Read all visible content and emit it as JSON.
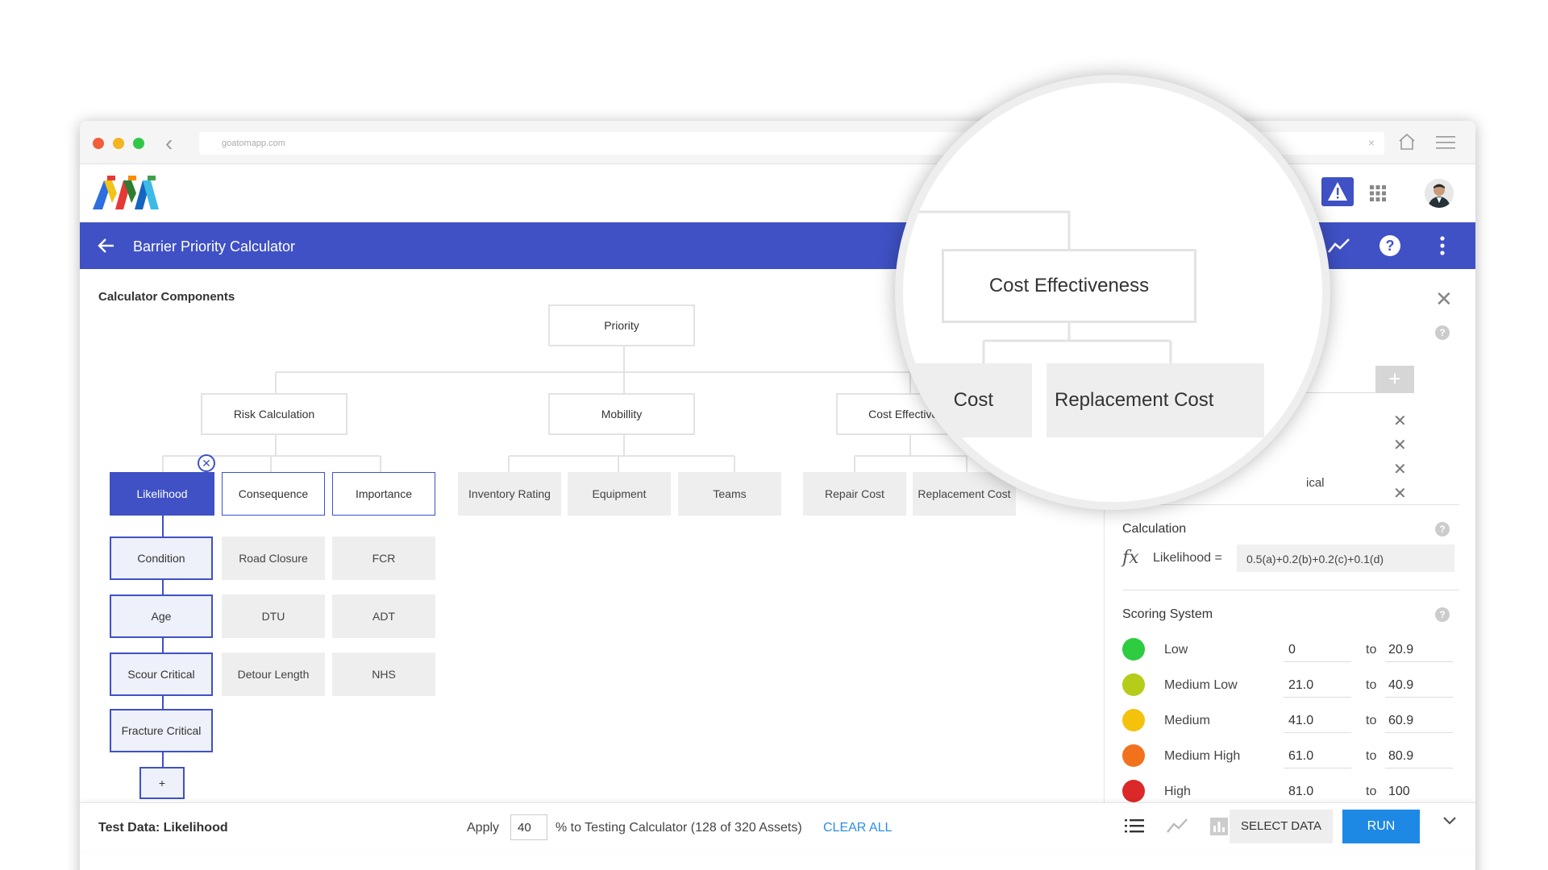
{
  "browser": {
    "url": "goatomapp.com"
  },
  "header": {
    "title": "Barrier Priority Calculator"
  },
  "components": {
    "title": "Calculator Components",
    "root": "Priority",
    "level1": [
      "Risk Calculation",
      "Mobillity",
      "Cost Effectivene"
    ],
    "risk": [
      "Likelihood",
      "Consequence",
      "Importance"
    ],
    "likelihood_children": [
      "Condition",
      "Age",
      "Scour Critical",
      "Fracture Critical"
    ],
    "consequence_children": [
      "Road Closure",
      "DTU",
      "Detour Length"
    ],
    "importance_children": [
      "FCR",
      "ADT",
      "NHS"
    ],
    "mobility_children": [
      "Inventory Rating",
      "Equipment",
      "Teams"
    ],
    "cost_children": [
      "Repair Cost",
      "Replacement Cost"
    ],
    "remove_glyph": "✕",
    "add_glyph": "+"
  },
  "magnifier": {
    "node": "Cost Effectiveness",
    "left_child": "Cost",
    "right_child": "Replacement Cost"
  },
  "panel": {
    "close": "✕",
    "help": "?",
    "add": "+",
    "remove": "✕",
    "partial_item": "ical",
    "calculation": {
      "heading": "Calculation",
      "fx": "fx",
      "label": "Likelihood =",
      "formula": "0.5(a)+0.2(b)+0.2(c)+0.1(d)"
    },
    "scoring": {
      "heading": "Scoring System",
      "to": "to",
      "rows": [
        {
          "label": "Low",
          "from": "0",
          "to": "20.9",
          "color": "#2ecc40"
        },
        {
          "label": "Medium Low",
          "from": "21.0",
          "to": "40.9",
          "color": "#b5cc18"
        },
        {
          "label": "Medium",
          "from": "41.0",
          "to": "60.9",
          "color": "#f4c20d"
        },
        {
          "label": "Medium High",
          "from": "61.0",
          "to": "80.9",
          "color": "#f2711c"
        },
        {
          "label": "High",
          "from": "81.0",
          "to": "100",
          "color": "#db2828"
        }
      ]
    }
  },
  "footer": {
    "test_data": "Test Data: Likelihood",
    "apply": "Apply",
    "percent": "40",
    "description": "% to Testing Calculator (128 of 320 Assets)",
    "clear": "CLEAR ALL",
    "select": "SELECT DATA",
    "run": "RUN"
  },
  "colors": {
    "primary": "#3f51c5",
    "accent": "#1e88e5",
    "link": "#2b8fe6"
  }
}
